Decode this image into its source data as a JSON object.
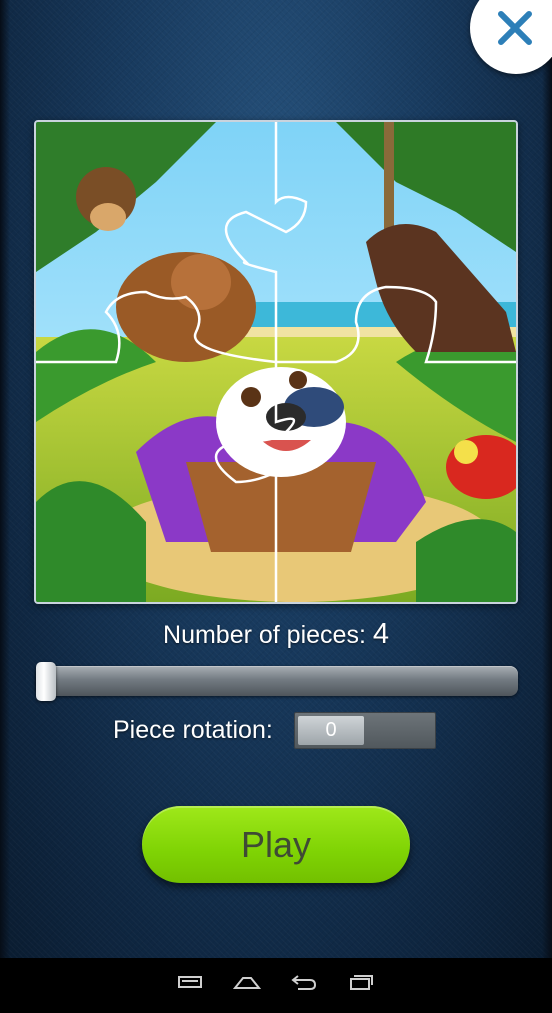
{
  "header": {
    "close_icon": "close-x-icon",
    "close_color": "#2d7fb8"
  },
  "puzzle": {
    "pieces_count": 4,
    "grid": "2x2",
    "image_description_icon": "puzzle-picture"
  },
  "settings": {
    "pieces_label": "Number of pieces:",
    "pieces_value": "4",
    "rotation_label": "Piece rotation:",
    "rotation_value": "0",
    "slider_level": 0
  },
  "actions": {
    "play_label": "Play",
    "play_color": "#8fdf0c"
  },
  "navbar": {
    "items": [
      {
        "icon": "menu-icon"
      },
      {
        "icon": "home-icon"
      },
      {
        "icon": "back-icon"
      },
      {
        "icon": "recent-apps-icon"
      }
    ]
  }
}
